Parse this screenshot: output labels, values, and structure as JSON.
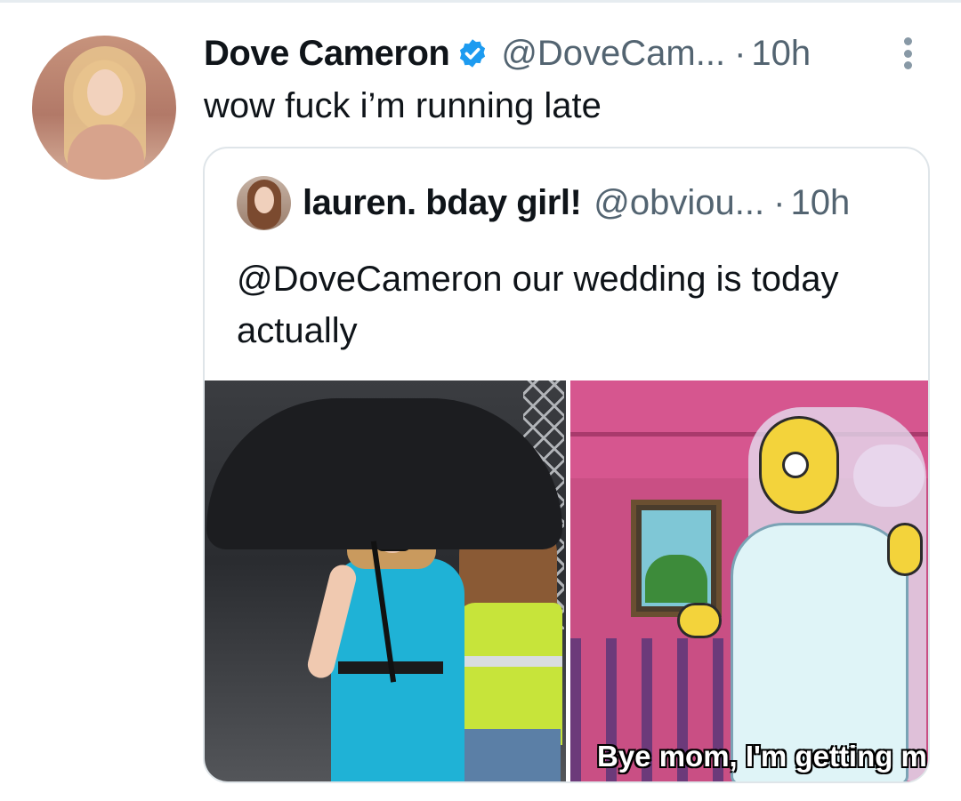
{
  "tweet": {
    "author_name": "Dove Cameron",
    "author_handle": "@DoveCam...",
    "separator": "·",
    "time": "10h",
    "text": "wow fuck i’m running late"
  },
  "quoted": {
    "author_name": "lauren. bday girl!",
    "author_handle": "@obviou...",
    "separator": "·",
    "time": "10h",
    "text": "@DoveCameron our wedding is today actually",
    "media": {
      "right_caption": "Bye mom, I'm getting m"
    }
  },
  "colors": {
    "verified": "#1d9bf0",
    "secondary_text": "#536471",
    "border": "#dfe5e9"
  }
}
